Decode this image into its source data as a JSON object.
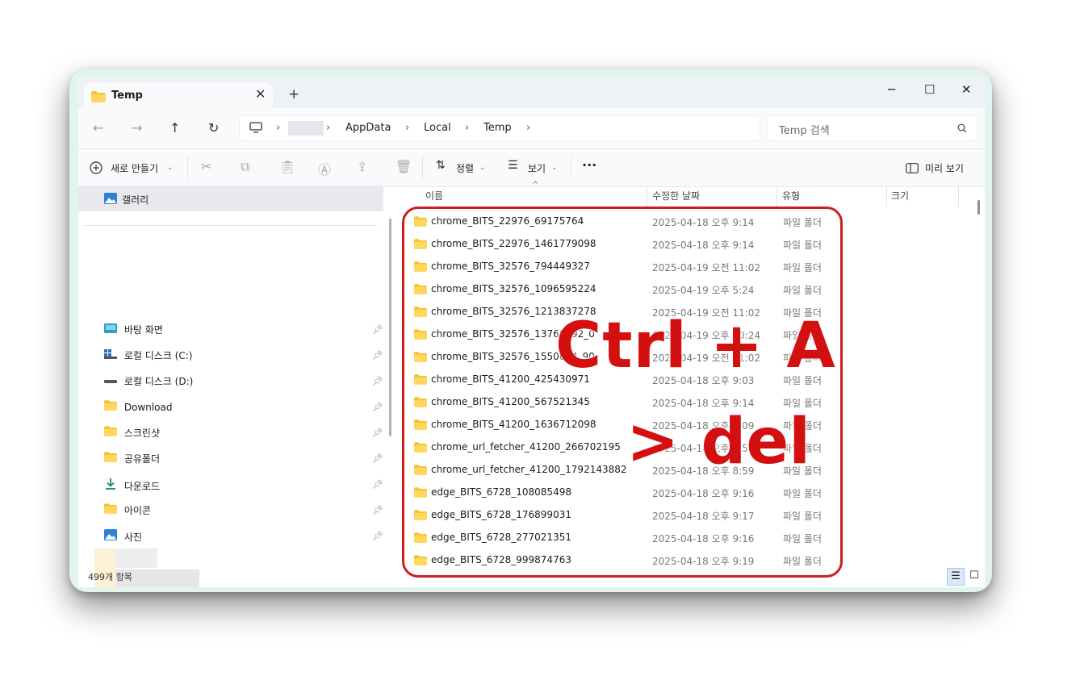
{
  "window": {
    "tab_title": "Temp",
    "tab_close": "✕",
    "new_tab": "+",
    "minimize": "─",
    "maximize": "☐",
    "close": "✕"
  },
  "nav": {
    "back_icon": "←",
    "forward_icon": "→",
    "up_icon": "↑",
    "refresh_icon": "↻",
    "breadcrumb": [
      "AppData",
      "Local",
      "Temp"
    ],
    "search_placeholder": "Temp 검색"
  },
  "toolbar": {
    "new_label": "새로 만들기",
    "sort_label": "정렬",
    "view_label": "보기",
    "more": "···",
    "preview_label": "미리 보기"
  },
  "sidebar": {
    "gallery": "갤러리",
    "items": [
      {
        "label": "바탕 화면",
        "icon": "desktop-icon"
      },
      {
        "label": "로컬 디스크 (C:)",
        "icon": "drive-c-icon"
      },
      {
        "label": "로컬 디스크 (D:)",
        "icon": "drive-d-icon"
      },
      {
        "label": "Download",
        "icon": "folder-icon"
      },
      {
        "label": "스크린샷",
        "icon": "folder-icon"
      },
      {
        "label": "공유폴더",
        "icon": "folder-icon"
      },
      {
        "label": "다운로드",
        "icon": "download-icon"
      },
      {
        "label": "아이콘",
        "icon": "folder-icon"
      },
      {
        "label": "사진",
        "icon": "pictures-icon"
      }
    ]
  },
  "columns": {
    "name": "이름",
    "date": "수정한 날짜",
    "type": "유형",
    "size": "크기"
  },
  "files": [
    {
      "name": "chrome_BITS_22976_69175764",
      "date": "2025-04-18 오후 9:14",
      "type": "파일 폴더"
    },
    {
      "name": "chrome_BITS_22976_1461779098",
      "date": "2025-04-18 오후 9:14",
      "type": "파일 폴더"
    },
    {
      "name": "chrome_BITS_32576_794449327",
      "date": "2025-04-19 오전 11:02",
      "type": "파일 폴더"
    },
    {
      "name": "chrome_BITS_32576_1096595224",
      "date": "2025-04-19 오후 5:24",
      "type": "파일 폴더"
    },
    {
      "name": "chrome_BITS_32576_1213837278",
      "date": "2025-04-19 오전 11:02",
      "type": "파일 폴더"
    },
    {
      "name": "chrome_BITS_32576_13768392_0",
      "date": "2025-04-19 오후 10:24",
      "type": "파일 폴더"
    },
    {
      "name": "chrome_BITS_32576_1550694_90",
      "date": "2025-04-19 오전 11:02",
      "type": "파일 폴더"
    },
    {
      "name": "chrome_BITS_41200_425430971",
      "date": "2025-04-18 오후 9:03",
      "type": "파일 폴더"
    },
    {
      "name": "chrome_BITS_41200_567521345",
      "date": "2025-04-18 오후 9:14",
      "type": "파일 폴더"
    },
    {
      "name": "chrome_BITS_41200_1636712098",
      "date": "2025-04-18 오후 9:09",
      "type": "파일 폴더"
    },
    {
      "name": "chrome_url_fetcher_41200_266702195",
      "date": "2025-04-18 오후 8:58",
      "type": "파일 폴더"
    },
    {
      "name": "chrome_url_fetcher_41200_1792143882",
      "date": "2025-04-18 오후 8:59",
      "type": "파일 폴더"
    },
    {
      "name": "edge_BITS_6728_108085498",
      "date": "2025-04-18 오후 9:16",
      "type": "파일 폴더"
    },
    {
      "name": "edge_BITS_6728_176899031",
      "date": "2025-04-18 오후 9:17",
      "type": "파일 폴더"
    },
    {
      "name": "edge_BITS_6728_277021351",
      "date": "2025-04-18 오후 9:16",
      "type": "파일 폴더"
    },
    {
      "name": "edge_BITS_6728_999874763",
      "date": "2025-04-18 오후 9:19",
      "type": "파일 폴더"
    }
  ],
  "status": {
    "count": "499개 항목"
  },
  "overlay": {
    "line1": "Ctrl + A",
    "line2": "> del",
    "color": "#d40f0f"
  }
}
